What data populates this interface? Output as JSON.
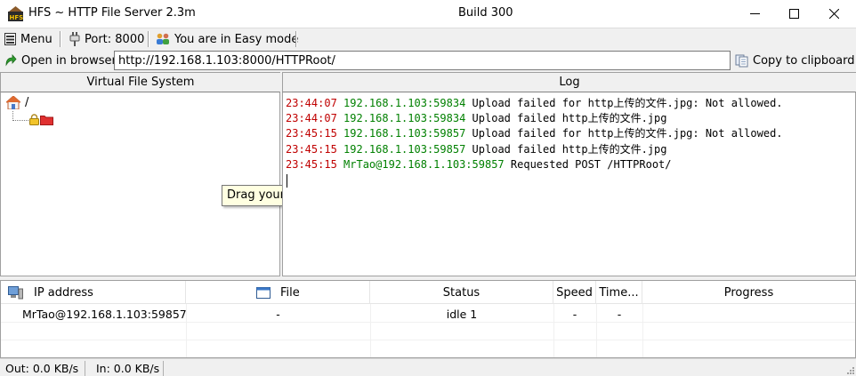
{
  "window": {
    "title": "HFS ~ HTTP File Server 2.3m",
    "build": "Build 300"
  },
  "toolbar": {
    "menu_label": "Menu",
    "port_label": "Port: 8000",
    "mode_label": "You are in Easy mode"
  },
  "urlbar": {
    "open_label": "Open in browser",
    "url": "http://192.168.1.103:8000/HTTPRoot/",
    "copy_label": "Copy to clipboard"
  },
  "vfs": {
    "header": "Virtual File System",
    "root_label": "/",
    "tooltip": "Drag your files here"
  },
  "log": {
    "header": "Log",
    "lines": [
      {
        "time": "23:44:07",
        "source": "192.168.1.103:59834",
        "message": "Upload failed for http上传的文件.jpg: Not allowed."
      },
      {
        "time": "23:44:07",
        "source": "192.168.1.103:59834",
        "message": "Upload failed http上传的文件.jpg"
      },
      {
        "time": "23:45:15",
        "source": "192.168.1.103:59857",
        "message": "Upload failed for http上传的文件.jpg: Not allowed."
      },
      {
        "time": "23:45:15",
        "source": "192.168.1.103:59857",
        "message": "Upload failed http上传的文件.jpg"
      },
      {
        "time": "23:45:15",
        "source": "MrTao@192.168.1.103:59857",
        "message": "Requested POST /HTTPRoot/"
      }
    ]
  },
  "connections": {
    "columns": {
      "ip": "IP address",
      "file": "File",
      "status": "Status",
      "speed": "Speed",
      "time": "Time...",
      "progress": "Progress"
    },
    "rows": [
      {
        "ip": "MrTao@192.168.1.103:59857",
        "file": "-",
        "status": "idle 1",
        "speed": "-",
        "time": "-",
        "progress": ""
      }
    ]
  },
  "statusbar": {
    "out": "Out: 0.0 KB/s",
    "in": "In: 0.0 KB/s"
  },
  "colors": {
    "log_time": "#c00000",
    "log_source": "#008000",
    "tooltip_bg": "#ffffe1"
  }
}
